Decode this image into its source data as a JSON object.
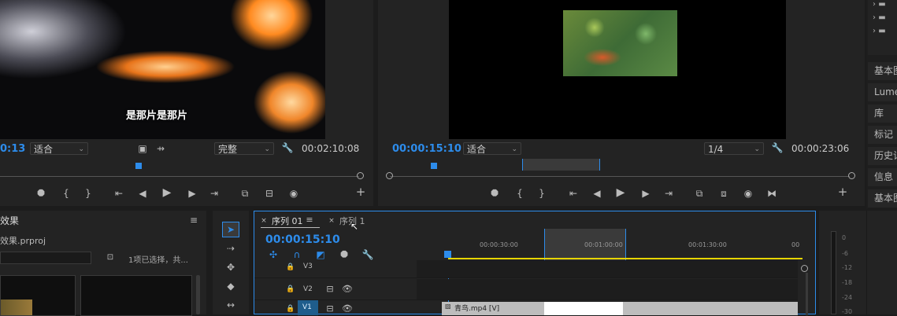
{
  "source_monitor": {
    "timecode_partial": "0:13",
    "fit_label": "适合",
    "quality_label": "完整",
    "duration": "00:02:10:08",
    "subtitle": "是那片是那片"
  },
  "program_monitor": {
    "timecode": "00:00:15:10",
    "fit_label": "适合",
    "quality_label": "1/4",
    "duration": "00:00:23:06"
  },
  "project_panel": {
    "title": "效果",
    "file": "效果.prproj",
    "selection_info": "1项已选择，共..."
  },
  "timeline": {
    "tabs": [
      "序列 01",
      "序列 1"
    ],
    "timecode": "00:00:15:10",
    "ruler_labels": [
      "00:00:30:00",
      "00:01:00:00",
      "00:01:30:00",
      "00"
    ],
    "tracks": [
      "V3",
      "V2",
      "V1"
    ],
    "clip_name": "青鸟.mp4 [V]"
  },
  "right_panels": [
    "基本图形",
    "Lumetri",
    "库",
    "标记",
    "历史记录",
    "信息",
    "基本图"
  ],
  "meter_scale": [
    "0",
    "-6",
    "-12",
    "-18",
    "-24",
    "-30"
  ],
  "colors": {
    "accent": "#2d8ceb",
    "playhead": "#2d8ceb",
    "work_area": "#e6d500"
  }
}
